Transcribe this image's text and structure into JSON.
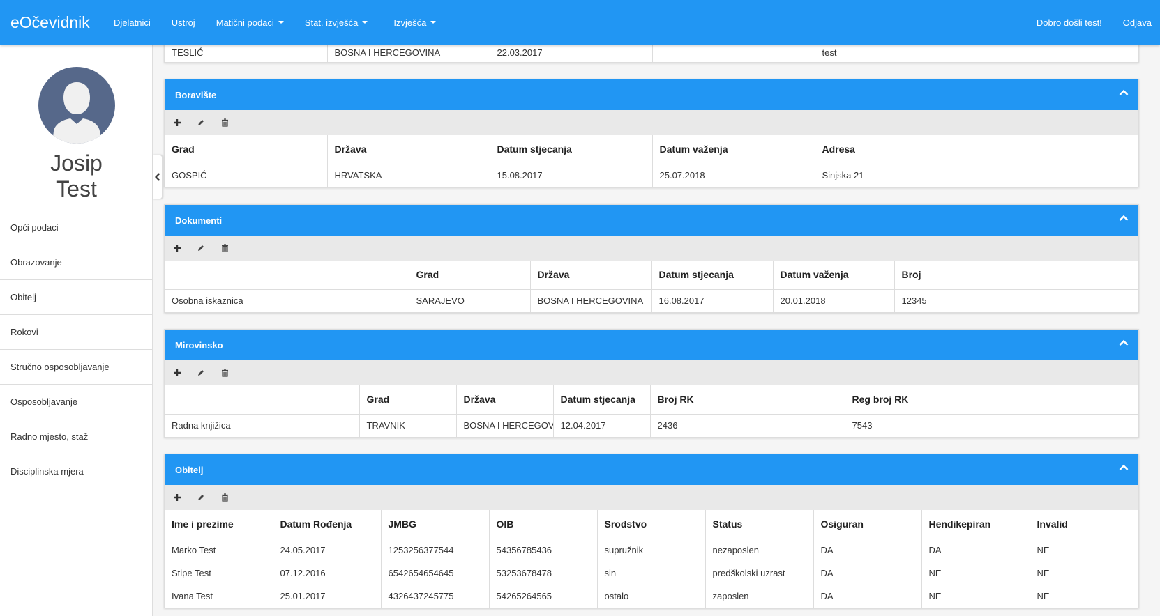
{
  "nav": {
    "brand": "eOčevidnik",
    "items": [
      {
        "label": "Djelatnici",
        "dropdown": false
      },
      {
        "label": "Ustroj",
        "dropdown": false
      },
      {
        "label": "Matični podaci",
        "dropdown": true
      },
      {
        "label": "Stat. izvješća",
        "dropdown": true
      },
      {
        "label": "Izvješća",
        "dropdown": true
      }
    ],
    "welcome": "Dobro došli test!",
    "logout": "Odjava"
  },
  "sidebar": {
    "first_name": "Josip",
    "last_name": "Test",
    "items": [
      "Opći podaci",
      "Obrazovanje",
      "Obitelj",
      "Rokovi",
      "Stručno osposobljavanje",
      "Osposobljavanje",
      "Radno mjesto, staž",
      "Disciplinska mjera"
    ]
  },
  "top_partial": {
    "row": [
      "TESLIĆ",
      "BOSNA I HERCEGOVINA",
      "22.03.2017",
      "",
      "test"
    ]
  },
  "boraviste": {
    "title": "Boravište",
    "headers": [
      "Grad",
      "Država",
      "Datum stjecanja",
      "Datum važenja",
      "Adresa"
    ],
    "rows": [
      [
        "GOSPIĆ",
        "HRVATSKA",
        "15.08.2017",
        "25.07.2018",
        "Sinjska 21"
      ]
    ]
  },
  "dokumenti": {
    "title": "Dokumenti",
    "headers": [
      "",
      "Grad",
      "Država",
      "Datum stjecanja",
      "Datum važenja",
      "Broj"
    ],
    "rows": [
      [
        "Osobna iskaznica",
        "SARAJEVO",
        "BOSNA I HERCEGOVINA",
        "16.08.2017",
        "20.01.2018",
        "12345"
      ]
    ]
  },
  "mirovinsko": {
    "title": "Mirovinsko",
    "headers": [
      "",
      "Grad",
      "Država",
      "Datum stjecanja",
      "Broj RK",
      "Reg broj RK"
    ],
    "rows": [
      [
        "Radna knjižica",
        "TRAVNIK",
        "BOSNA I HERCEGOVINA",
        "12.04.2017",
        "2436",
        "7543"
      ]
    ]
  },
  "obitelj": {
    "title": "Obitelj",
    "headers": [
      "Ime i prezime",
      "Datum Rođenja",
      "JMBG",
      "OIB",
      "Srodstvo",
      "Status",
      "Osiguran",
      "Hendikepiran",
      "Invalid"
    ],
    "rows": [
      [
        "Marko Test",
        "24.05.2017",
        "1253256377544",
        "54356785436",
        "supružnik",
        "nezaposlen",
        "DA",
        "DA",
        "NE"
      ],
      [
        "Stipe Test",
        "07.12.2016",
        "6542654654645",
        "53253678478",
        "sin",
        "predškolski uzrast",
        "DA",
        "NE",
        "NE"
      ],
      [
        "Ivana Test",
        "25.01.2017",
        "4326437245775",
        "54265264565",
        "ostalo",
        "zaposlen",
        "DA",
        "NE",
        "NE"
      ]
    ]
  },
  "colors": {
    "primary": "#2196f3",
    "toolbar": "#e9e9e9",
    "avatar": "#56688a"
  },
  "icons": {
    "add": "plus-icon",
    "edit": "pencil-icon",
    "delete": "trash-icon",
    "collapse": "chevron-up-icon",
    "sidebar_toggle": "chevron-left-icon",
    "avatar": "user-silhouette-icon"
  }
}
